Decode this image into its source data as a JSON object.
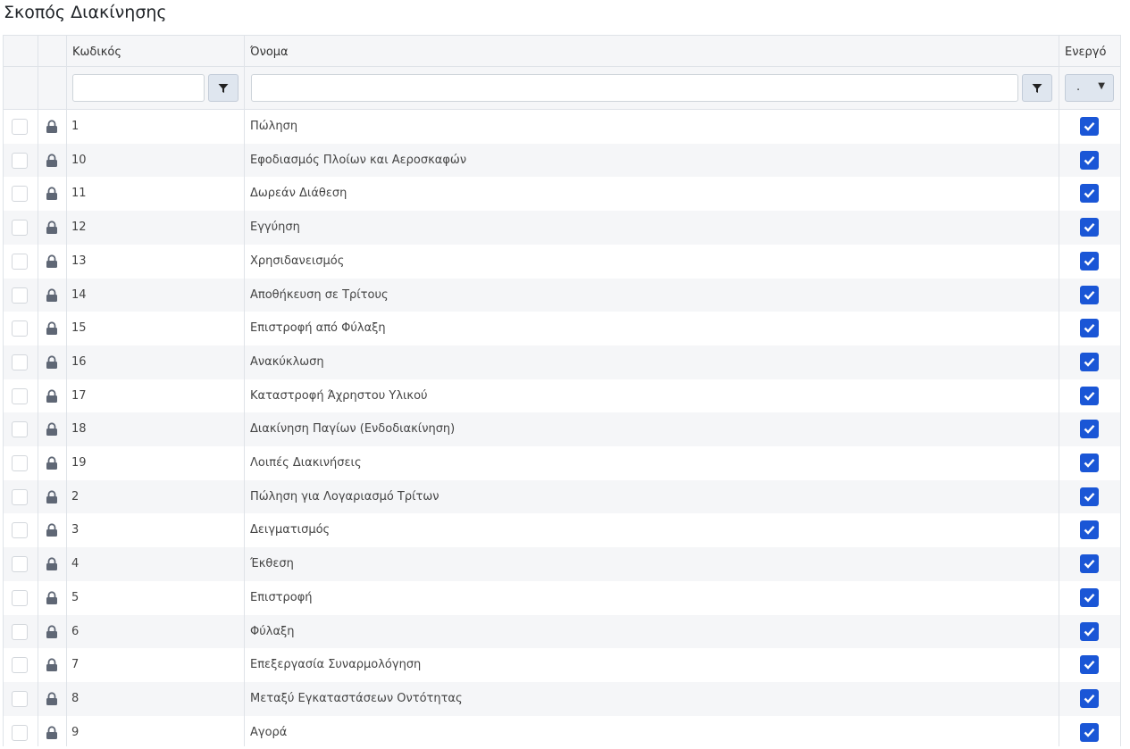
{
  "page": {
    "title": "Σκοπός Διακίνησης"
  },
  "columns": {
    "code": "Κωδικός",
    "name": "Όνομα",
    "active": "Ενεργό"
  },
  "filters": {
    "code_value": "",
    "name_value": "",
    "active_value": ".",
    "filter_icon": "filter-icon",
    "caret_icon": "chevron-down-icon"
  },
  "colors": {
    "accent": "#1a56d6",
    "header_bg": "#f5f6f8",
    "border": "#dfe3e8",
    "lock": "#5f6775"
  },
  "rows": [
    {
      "code": "1",
      "name": "Πώληση",
      "active": true
    },
    {
      "code": "10",
      "name": "Εφοδιασμός Πλοίων και Αεροσκαφών",
      "active": true
    },
    {
      "code": "11",
      "name": "Δωρεάν Διάθεση",
      "active": true
    },
    {
      "code": "12",
      "name": "Εγγύηση",
      "active": true
    },
    {
      "code": "13",
      "name": "Χρησιδανεισμός",
      "active": true
    },
    {
      "code": "14",
      "name": "Αποθήκευση σε Τρίτους",
      "active": true
    },
    {
      "code": "15",
      "name": "Επιστροφή από Φύλαξη",
      "active": true
    },
    {
      "code": "16",
      "name": "Ανακύκλωση",
      "active": true
    },
    {
      "code": "17",
      "name": "Καταστροφή Άχρηστου Υλικού",
      "active": true
    },
    {
      "code": "18",
      "name": "Διακίνηση Παγίων (Ενδοδιακίνηση)",
      "active": true
    },
    {
      "code": "19",
      "name": "Λοιπές Διακινήσεις",
      "active": true
    },
    {
      "code": "2",
      "name": "Πώληση για Λογαριασμό Τρίτων",
      "active": true
    },
    {
      "code": "3",
      "name": "Δειγματισμός",
      "active": true
    },
    {
      "code": "4",
      "name": "Έκθεση",
      "active": true
    },
    {
      "code": "5",
      "name": "Επιστροφή",
      "active": true
    },
    {
      "code": "6",
      "name": "Φύλαξη",
      "active": true
    },
    {
      "code": "7",
      "name": "Επεξεργασία Συναρμολόγηση",
      "active": true
    },
    {
      "code": "8",
      "name": "Μεταξύ Εγκαταστάσεων Οντότητας",
      "active": true
    },
    {
      "code": "9",
      "name": "Αγορά",
      "active": true
    }
  ]
}
